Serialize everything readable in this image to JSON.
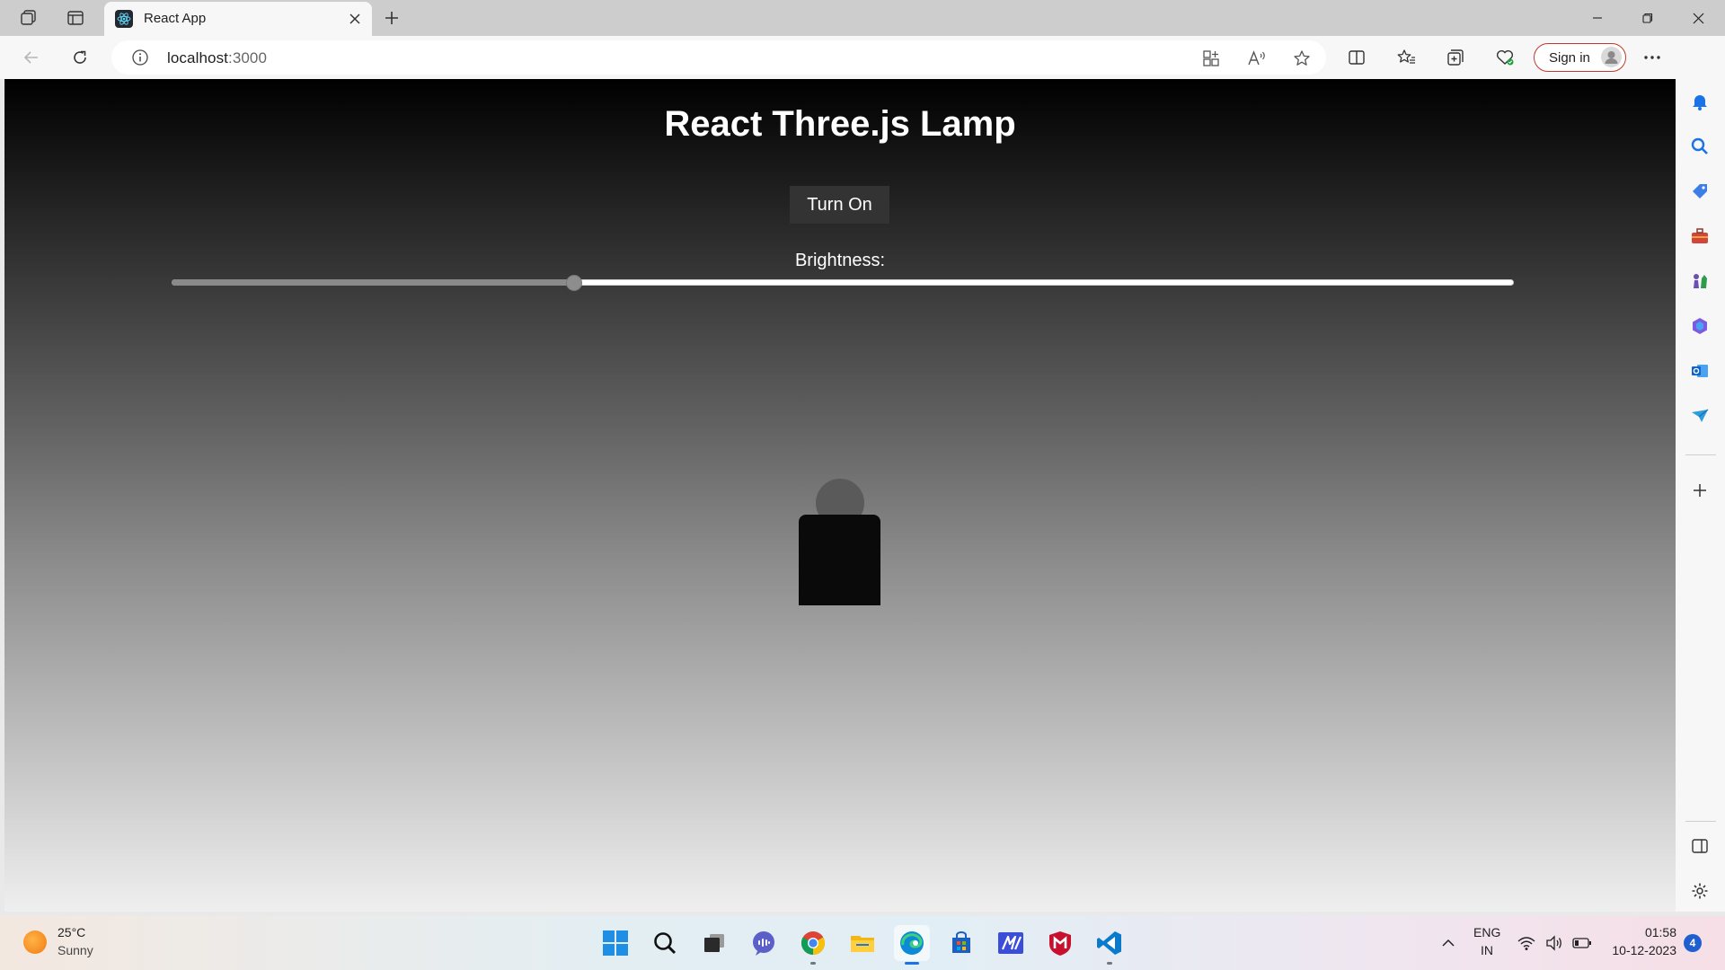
{
  "browser": {
    "tab": {
      "title": "React App",
      "favicon": "react-logo-icon"
    },
    "address": {
      "host": "localhost",
      "port": ":3000"
    },
    "signin_label": "Sign in",
    "colors": {
      "signin_border": "#c0392b",
      "tab_bg": "#f7f7f7",
      "strip_bg": "#cdcdcd"
    }
  },
  "page": {
    "title": "React Three.js Lamp",
    "toggle_label": "Turn On",
    "brightness_label": "Brightness:",
    "brightness_value": 0.3,
    "lamp": {
      "state": "off",
      "head_color": "#5a5a5a",
      "body_color": "#0a0a0a"
    }
  },
  "sidebar": {
    "icons": [
      "bell-icon",
      "search-icon",
      "tag-icon",
      "toolbox-icon",
      "chess-icon",
      "office-icon",
      "outlook-icon",
      "send-icon",
      "add-icon",
      "panel-icon",
      "settings-icon"
    ]
  },
  "taskbar": {
    "weather": {
      "temp": "25°C",
      "desc": "Sunny"
    },
    "apps": [
      "windows-start-icon",
      "search-icon",
      "task-view-icon",
      "teams-chat-icon",
      "chrome-icon",
      "file-explorer-icon",
      "edge-icon",
      "store-icon",
      "mathpad-icon",
      "mcafee-icon",
      "vscode-icon"
    ],
    "tray": {
      "lang": "ENG",
      "region": "IN",
      "time": "01:58",
      "date": "10-12-2023",
      "notifications": "4"
    }
  }
}
